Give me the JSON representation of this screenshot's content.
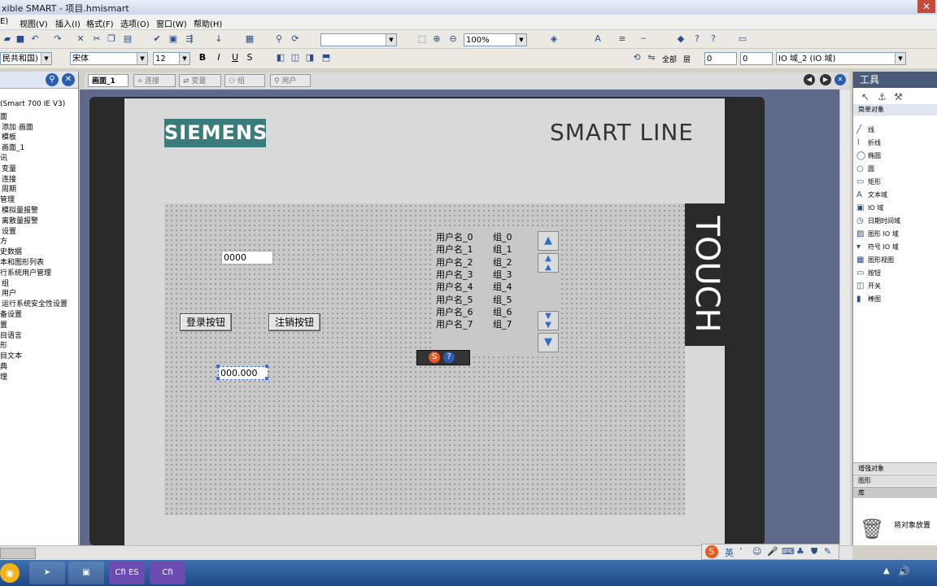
{
  "window": {
    "title": "xible SMART - 项目.hmismart"
  },
  "menu": [
    "E)",
    "视图(V)",
    "插入(I)",
    "格式(F)",
    "选项(O)",
    "窗口(W)",
    "帮助(H)"
  ],
  "toolbar": {
    "zoom": "100%",
    "language_combo": "民共和国)",
    "font_combo": "宋体",
    "size_combo": "12",
    "all_label": "全部",
    "layer_label": "层",
    "spin1": "0",
    "spin2": "0",
    "object_combo": "IO 域_2 (IO 域)"
  },
  "project_tree": [
    "(Smart 700 IE V3)",
    "面",
    "添加 画面",
    "模板",
    "画面_1",
    "讯",
    "变量",
    "连接",
    "周期",
    "管理",
    "模拟量报警",
    "离散量报警",
    "设置",
    "方",
    "史数据",
    "本和图形列表",
    "行系统用户管理",
    "组",
    "用户",
    "运行系统安全性设置",
    "备设置",
    "置",
    "目语言",
    "形",
    "目文本",
    "典",
    "理"
  ],
  "tabs": [
    "画面_1",
    "连接",
    "变量",
    "组",
    "用户"
  ],
  "panel": {
    "brand": "SIEMENS",
    "series": "SMART LINE",
    "touch": "TOUCH"
  },
  "screen": {
    "io_field_top": "0000",
    "login_button": "登录按钮",
    "logout_button": "注销按钮",
    "io_field_bottom": "000.000"
  },
  "user_view": {
    "rows": [
      {
        "user": "用户名_0",
        "group": "组_0"
      },
      {
        "user": "用户名_1",
        "group": "组_1"
      },
      {
        "user": "用户名_2",
        "group": "组_2"
      },
      {
        "user": "用户名_3",
        "group": "组_3"
      },
      {
        "user": "用户名_4",
        "group": "组_4"
      },
      {
        "user": "用户名_5",
        "group": "组_5"
      },
      {
        "user": "用户名_6",
        "group": "组_6"
      },
      {
        "user": "用户名_7",
        "group": "组_7"
      }
    ]
  },
  "toolbox": {
    "title": "工具",
    "simple_objects": "简单对象",
    "items": [
      "线",
      "折线",
      "椭圆",
      "圆",
      "矩形",
      "文本域",
      "IO 域",
      "日期时间域",
      "图形 IO 域",
      "符号 IO 域",
      "图形视图",
      "按钮",
      "开关",
      "棒图"
    ],
    "enhanced_objects": "增强对象",
    "graphics": "图形",
    "library": "库",
    "library_hint": "将对象放置"
  },
  "ime": {
    "lang": "英"
  },
  "taskbar": {
    "app1": "CfI ES",
    "app2": "CfI"
  }
}
